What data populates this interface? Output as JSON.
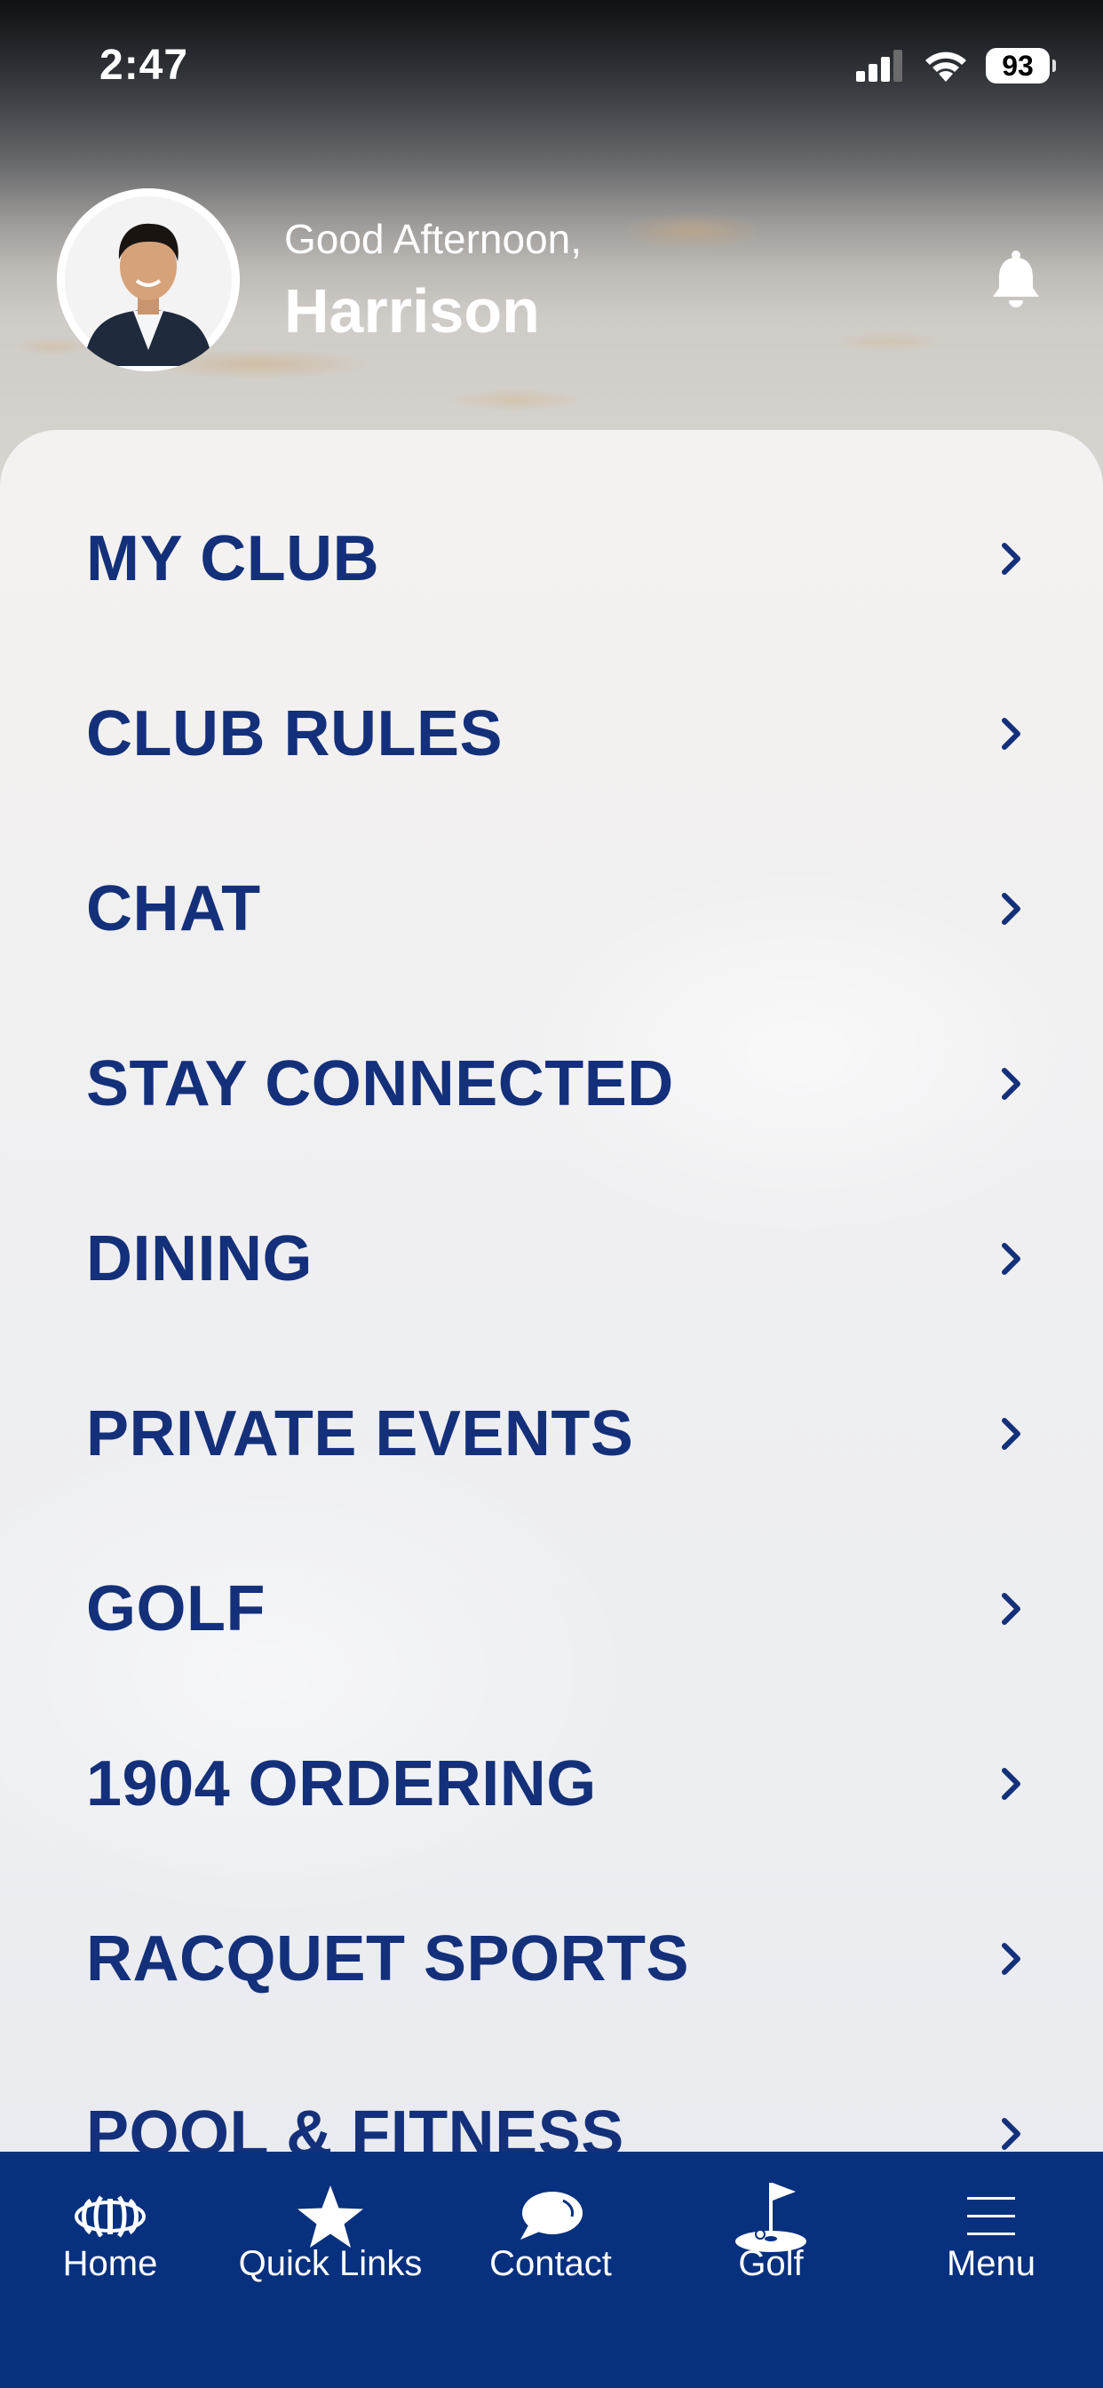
{
  "status_bar": {
    "time": "2:47",
    "battery": "93"
  },
  "header": {
    "greeting": "Good Afternoon,",
    "name": "Harrison"
  },
  "menu": {
    "items": [
      {
        "label": "MY CLUB"
      },
      {
        "label": "CLUB RULES"
      },
      {
        "label": "CHAT"
      },
      {
        "label": "STAY CONNECTED"
      },
      {
        "label": "DINING"
      },
      {
        "label": "PRIVATE EVENTS"
      },
      {
        "label": "GOLF"
      },
      {
        "label": "1904 ORDERING"
      },
      {
        "label": "RACQUET SPORTS"
      },
      {
        "label": "POOL & FITNESS"
      }
    ]
  },
  "tabbar": {
    "tabs": [
      {
        "label": "Home",
        "icon": "club-logo-icon"
      },
      {
        "label": "Quick Links",
        "icon": "star-icon"
      },
      {
        "label": "Contact",
        "icon": "chat-bubble-icon"
      },
      {
        "label": "Golf",
        "icon": "golf-flag-icon"
      },
      {
        "label": "Menu",
        "icon": "hamburger-icon"
      }
    ]
  },
  "colors": {
    "brand_navy": "#07307e",
    "menu_text": "#14307a"
  }
}
